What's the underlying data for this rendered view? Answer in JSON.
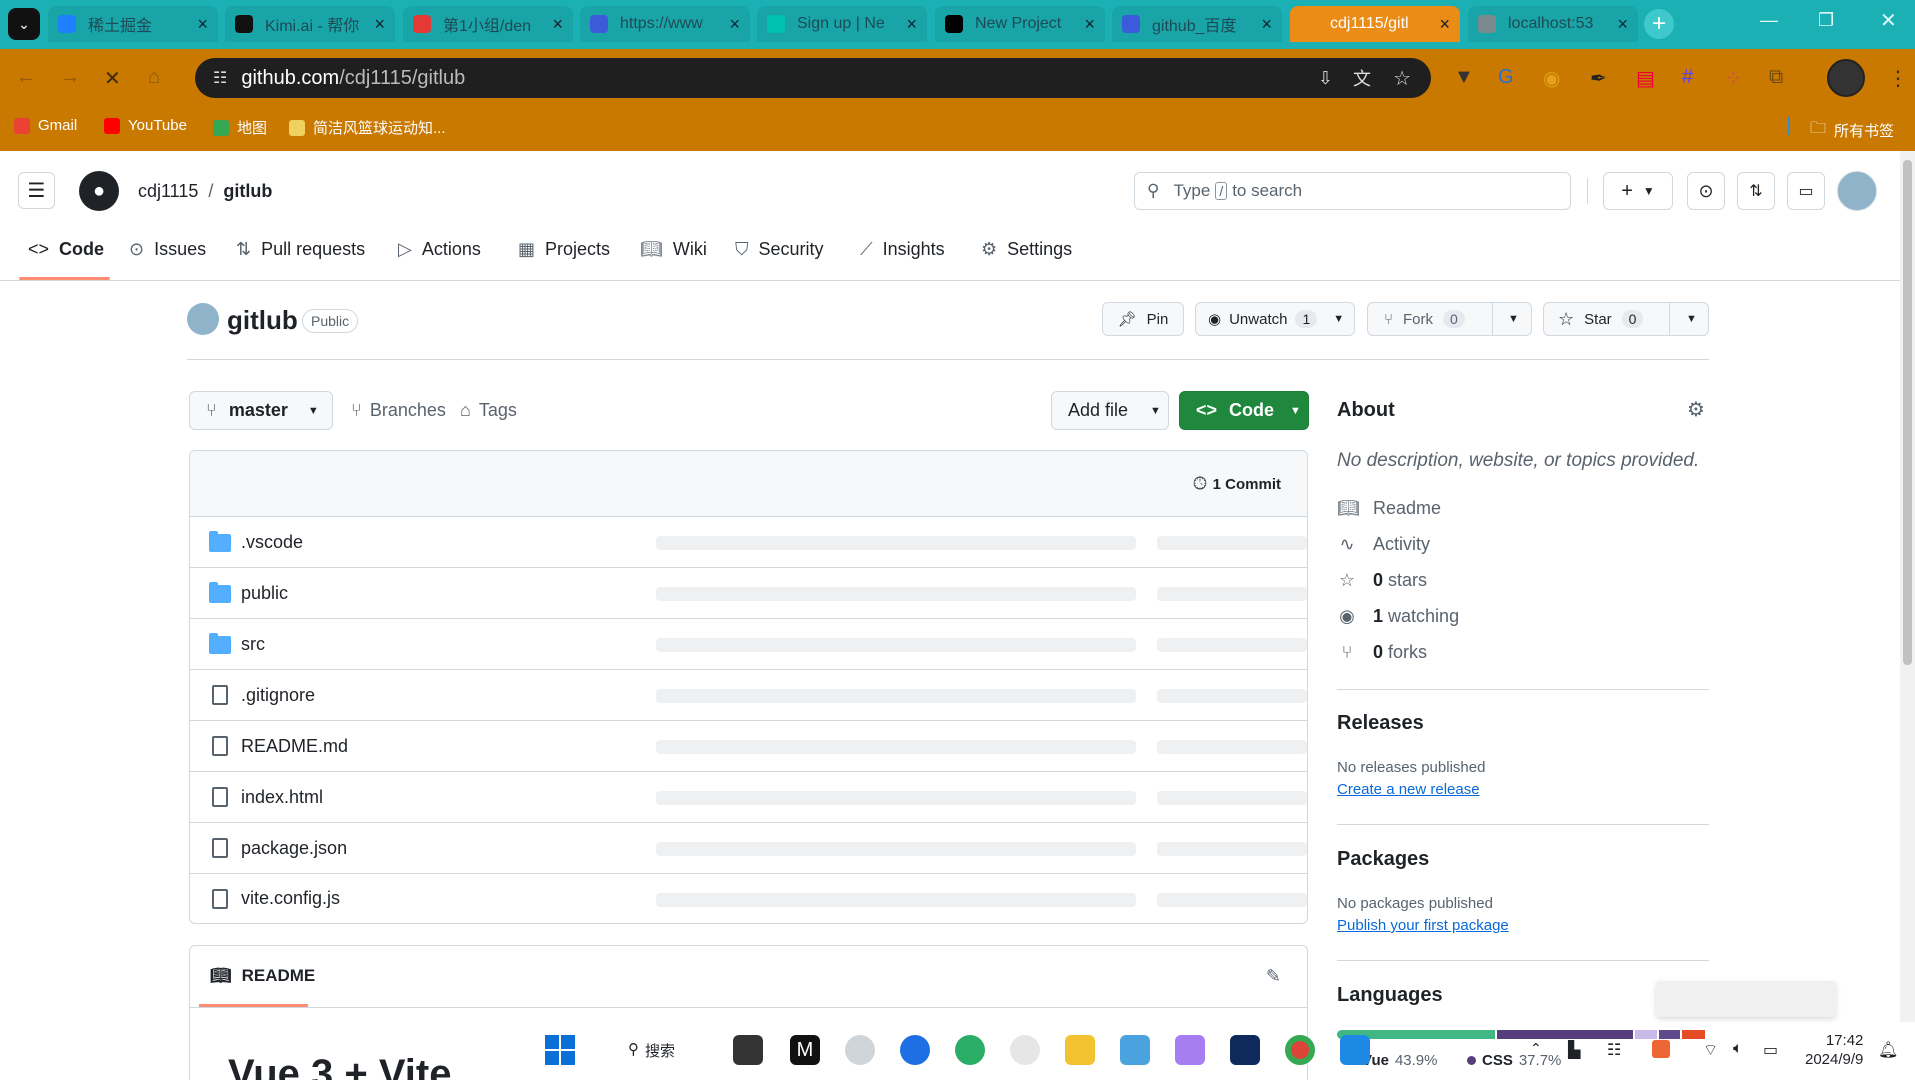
{
  "browser": {
    "tabs": [
      {
        "title": "稀土掘金",
        "color": "#1e80ff"
      },
      {
        "title": "Kimi.ai - 帮你",
        "color": "#111111"
      },
      {
        "title": "第1小组/den",
        "color": "#e53935"
      },
      {
        "title": "https://www",
        "color": "#3b5bdb"
      },
      {
        "title": "Sign up | Ne",
        "color": "#00c2b2"
      },
      {
        "title": "New Project",
        "color": "#000000"
      },
      {
        "title": "github_百度",
        "color": "#3b5bdb"
      },
      {
        "title": "cdj1115/gitl",
        "color": "#ea8c15"
      },
      {
        "title": "localhost:53",
        "color": "#7a8a8f"
      }
    ],
    "url_host": "github.com",
    "url_path": "/cdj1115/gitlub",
    "bookmarks": [
      "Gmail",
      "YouTube",
      "地图",
      "简洁风篮球运动知..."
    ],
    "bookmarks_right": "所有书签"
  },
  "gh": {
    "owner": "cdj1115",
    "sep": "/",
    "repo": "gitlub",
    "search_placeholder": "Type / to search",
    "search_pre": "Type",
    "search_key": "/",
    "search_post": "to search",
    "nav": [
      "Code",
      "Issues",
      "Pull requests",
      "Actions",
      "Projects",
      "Wiki",
      "Security",
      "Insights",
      "Settings"
    ],
    "repo_title": "gitlub",
    "visibility": "Public",
    "pin": "Pin",
    "unwatch": "Unwatch",
    "unwatch_count": "1",
    "fork": "Fork",
    "fork_count": "0",
    "star": "Star",
    "star_count": "0",
    "branch": "master",
    "branches": "Branches",
    "tags": "Tags",
    "add_file": "Add file",
    "code_btn": "Code",
    "commits": "1 Commit",
    "files": [
      {
        "name": ".vscode",
        "type": "folder"
      },
      {
        "name": "public",
        "type": "folder"
      },
      {
        "name": "src",
        "type": "folder"
      },
      {
        "name": ".gitignore",
        "type": "file"
      },
      {
        "name": "README.md",
        "type": "file"
      },
      {
        "name": "index.html",
        "type": "file"
      },
      {
        "name": "package.json",
        "type": "file"
      },
      {
        "name": "vite.config.js",
        "type": "file"
      }
    ],
    "readme_tab": "README",
    "readme_heading": "Vue 3 + Vite",
    "about": {
      "title": "About",
      "desc": "No description, website, or topics provided.",
      "readme": "Readme",
      "activity": "Activity",
      "stars_n": "0",
      "stars": "stars",
      "watching_n": "1",
      "watching": "watching",
      "forks_n": "0",
      "forks": "forks"
    },
    "releases": {
      "title": "Releases",
      "none": "No releases published",
      "link": "Create a new release"
    },
    "packages": {
      "title": "Packages",
      "none": "No packages published",
      "link": "Publish your first package"
    },
    "languages": {
      "title": "Languages",
      "items": [
        {
          "name": "Vue",
          "pct": "43.9%",
          "value": 43.9,
          "color": "#41b883"
        },
        {
          "name": "CSS",
          "pct": "37.7%",
          "value": 37.7,
          "color": "#563d7c"
        }
      ],
      "rest_segments": [
        {
          "value": 6.2,
          "color": "#c9b8e8"
        },
        {
          "value": 5.7,
          "color": "#5f4b8b"
        },
        {
          "value": 6.5,
          "color": "#e34c26"
        }
      ],
      "last_color": "#f1e05a"
    }
  },
  "taskbar": {
    "search": "搜索",
    "time": "17:42",
    "date": "2024/9/9"
  }
}
